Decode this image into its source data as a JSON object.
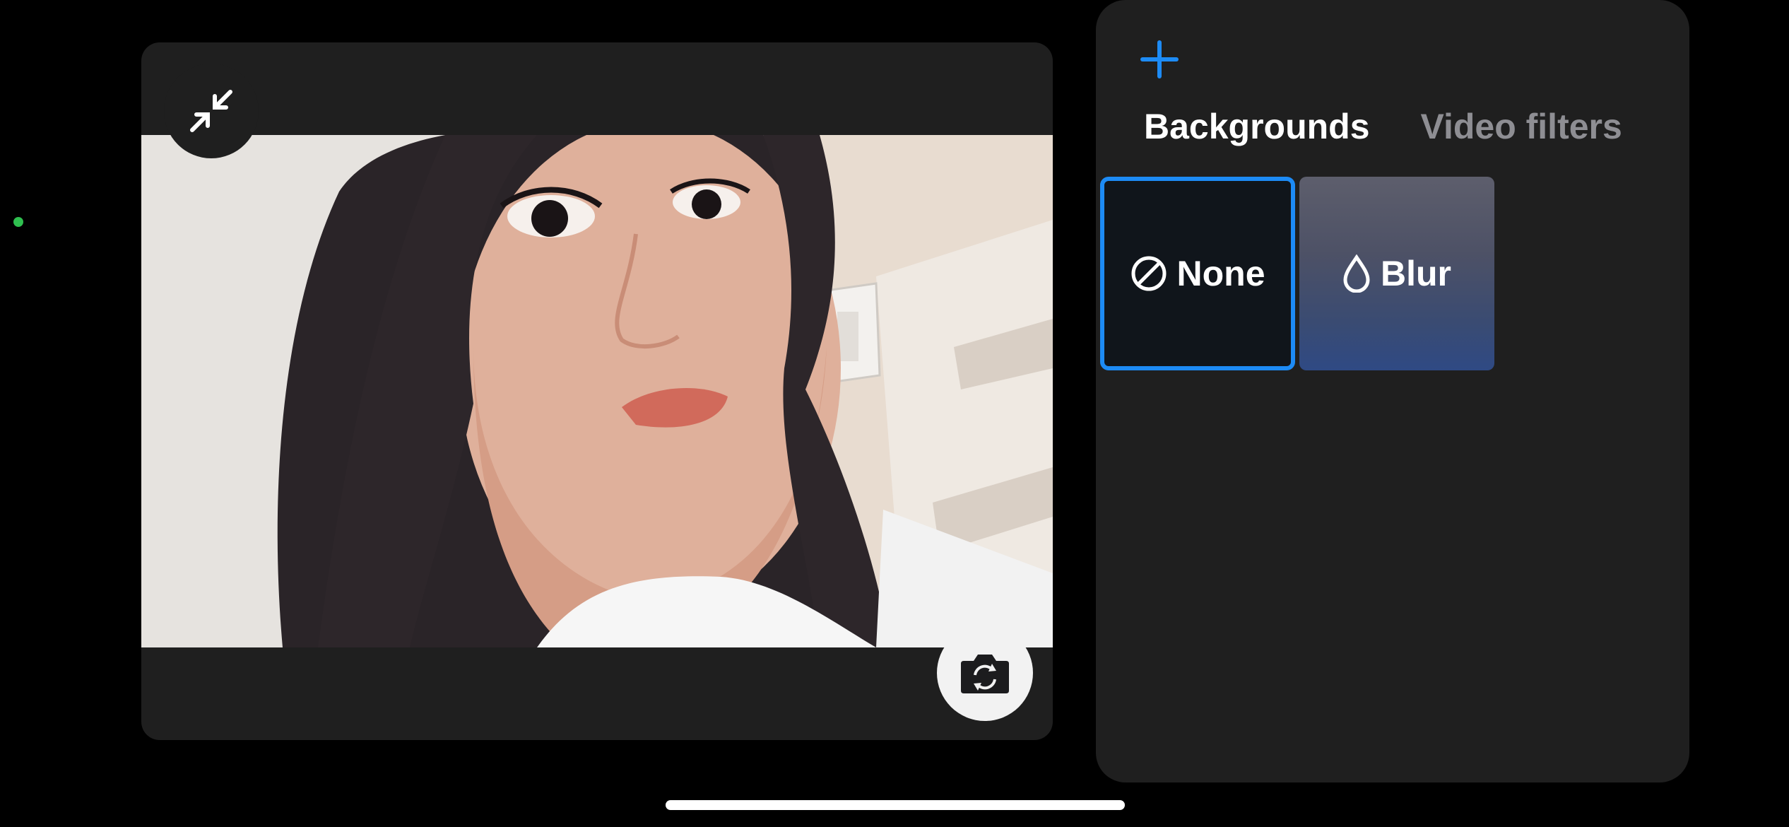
{
  "panel": {
    "add_label": "+",
    "tabs": [
      {
        "label": "Backgrounds",
        "active": true
      },
      {
        "label": "Video filters",
        "active": false
      }
    ],
    "tiles": [
      {
        "label": "None",
        "icon": "prohibited-icon",
        "selected": true
      },
      {
        "label": "Blur",
        "icon": "droplet-icon",
        "selected": false
      }
    ]
  },
  "colors": {
    "accent": "#1d8bf5",
    "status": "#2fbf4f",
    "panel_bg": "#1f1f1f"
  },
  "preview": {
    "collapse_icon": "collapse-arrows-icon",
    "flip_icon": "camera-flip-icon"
  }
}
